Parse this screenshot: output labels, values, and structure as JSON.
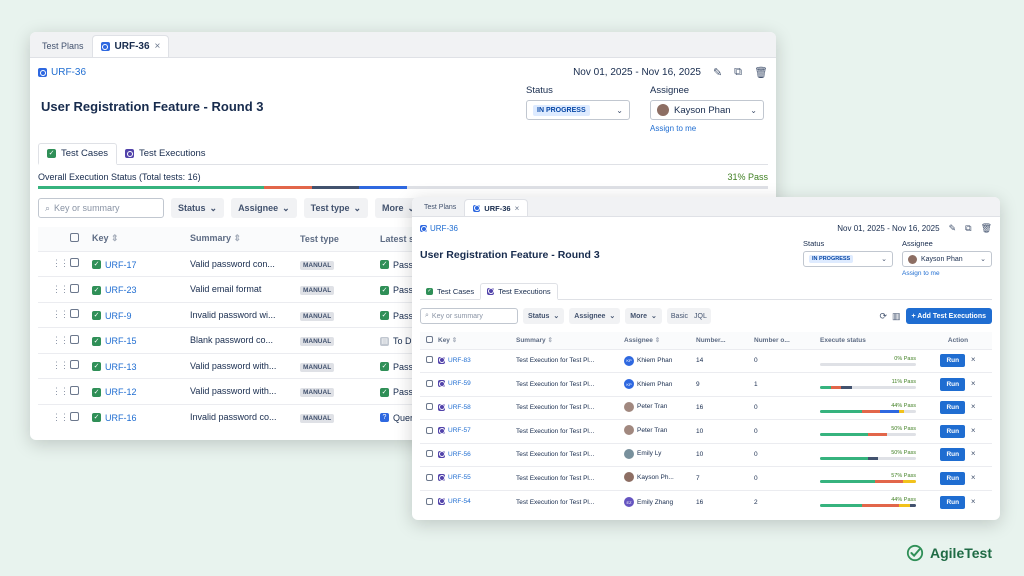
{
  "colors": {
    "pass": "#36b37e",
    "fail": "#e2664a",
    "todo": "#42526e",
    "exec": "#2e68e0",
    "blocked": "#f2c21b"
  },
  "back": {
    "tabs": [
      {
        "label": "Test Plans"
      },
      {
        "label": "URF-36",
        "close": "×"
      }
    ],
    "key": "URF-36",
    "date_range": "Nov 01, 2025 - Nov 16, 2025",
    "title": "User Registration Feature - Round 3",
    "status_label": "Status",
    "status_value": "IN PROGRESS",
    "assignee_label": "Assignee",
    "assignee_value": "Kayson Phan",
    "assign_to_me": "Assign to me",
    "subtabs": [
      "Test Cases",
      "Test Executions"
    ],
    "overall_status": "Overall Execution Status (Total tests: 16)",
    "overall_pass": "31% Pass",
    "overall_progress": [
      {
        "status": "pass",
        "pct": 31
      },
      {
        "status": "fail",
        "pct": 6.5
      },
      {
        "status": "todo",
        "pct": 6.5
      },
      {
        "status": "exec",
        "pct": 6.5
      }
    ],
    "search_placeholder": "Key or summary",
    "filters": [
      "Status",
      "Assignee",
      "Test type",
      "More"
    ],
    "columns": {
      "key": "Key",
      "summary": "Summary",
      "type": "Test type",
      "latest": "Latest s"
    },
    "rows": [
      {
        "key": "URF-17",
        "summary": "Valid password con...",
        "type": "MANUAL",
        "latest": "Pass"
      },
      {
        "key": "URF-23",
        "summary": "Valid email format",
        "type": "MANUAL",
        "latest": "Pass"
      },
      {
        "key": "URF-9",
        "summary": "Invalid password wi...",
        "type": "MANUAL",
        "latest": "Pass"
      },
      {
        "key": "URF-15",
        "summary": "Blank password co...",
        "type": "MANUAL",
        "latest": "To D"
      },
      {
        "key": "URF-13",
        "summary": "Valid password with...",
        "type": "MANUAL",
        "latest": "Pass"
      },
      {
        "key": "URF-12",
        "summary": "Valid password with...",
        "type": "MANUAL",
        "latest": "Pass"
      },
      {
        "key": "URF-16",
        "summary": "Invalid password co...",
        "type": "MANUAL",
        "latest": "Quer"
      }
    ]
  },
  "front": {
    "tabs": [
      {
        "label": "Test Plans"
      },
      {
        "label": "URF-36",
        "close": "×"
      }
    ],
    "key": "URF-36",
    "date_range": "Nov 01, 2025 - Nov 16, 2025",
    "title": "User Registration Feature - Round 3",
    "status_label": "Status",
    "status_value": "IN PROGRESS",
    "assignee_label": "Assignee",
    "assignee_value": "Kayson Phan",
    "assign_to_me": "Assign to me",
    "subtabs": [
      "Test Cases",
      "Test Executions"
    ],
    "search_placeholder": "Key or summary",
    "filters": [
      "Status",
      "Assignee",
      "More"
    ],
    "mode_basic": "Basic",
    "mode_jql": "JQL",
    "add_button": "+ Add Test Executions",
    "columns": {
      "key": "Key",
      "summary": "Summary",
      "assignee": "Assignee",
      "num1": "Number...",
      "num2": "Number o...",
      "exec": "Execute status",
      "action": "Action"
    },
    "run_label": "Run",
    "remove": "×",
    "rows": [
      {
        "key": "URF-83",
        "summary": "Test Execution for Test Pl...",
        "assignee": "Khiem Phan",
        "initials": "KP",
        "n1": "14",
        "n2": "0",
        "pass": "0% Pass",
        "bar": []
      },
      {
        "key": "URF-59",
        "summary": "Test Execution for Test Pl...",
        "assignee": "Khiem Phan",
        "initials": "KP",
        "n1": "9",
        "n2": "1",
        "pass": "11% Pass",
        "bar": [
          {
            "status": "pass",
            "pct": 11
          },
          {
            "status": "fail",
            "pct": 11
          },
          {
            "status": "todo",
            "pct": 11
          }
        ]
      },
      {
        "key": "URF-58",
        "summary": "Test Execution for Test Pl...",
        "assignee": "Peter Tran",
        "initials": "",
        "n1": "16",
        "n2": "0",
        "pass": "44% Pass",
        "bar": [
          {
            "status": "pass",
            "pct": 44
          },
          {
            "status": "fail",
            "pct": 19
          },
          {
            "status": "exec",
            "pct": 19
          },
          {
            "status": "blocked",
            "pct": 6
          }
        ]
      },
      {
        "key": "URF-57",
        "summary": "Test Execution for Test Pl...",
        "assignee": "Peter Tran",
        "initials": "",
        "n1": "10",
        "n2": "0",
        "pass": "50% Pass",
        "bar": [
          {
            "status": "pass",
            "pct": 50
          },
          {
            "status": "fail",
            "pct": 20
          }
        ]
      },
      {
        "key": "URF-56",
        "summary": "Test Execution for Test Pl...",
        "assignee": "Emily Ly",
        "initials": "",
        "n1": "10",
        "n2": "0",
        "pass": "50% Pass",
        "bar": [
          {
            "status": "pass",
            "pct": 50
          },
          {
            "status": "todo",
            "pct": 10
          }
        ]
      },
      {
        "key": "URF-55",
        "summary": "Test Execution for Test Pl...",
        "assignee": "Kayson Ph...",
        "initials": "",
        "n1": "7",
        "n2": "0",
        "pass": "57% Pass",
        "bar": [
          {
            "status": "pass",
            "pct": 57
          },
          {
            "status": "fail",
            "pct": 29
          },
          {
            "status": "blocked",
            "pct": 14
          }
        ]
      },
      {
        "key": "URF-54",
        "summary": "Test Execution for Test Pl...",
        "assignee": "Emily Zhang",
        "initials": "EZ",
        "n1": "16",
        "n2": "2",
        "pass": "44% Pass",
        "bar": [
          {
            "status": "pass",
            "pct": 44
          },
          {
            "status": "fail",
            "pct": 38
          },
          {
            "status": "blocked",
            "pct": 12
          },
          {
            "status": "todo",
            "pct": 6
          }
        ]
      }
    ]
  },
  "brand": {
    "name": "AgileTest"
  }
}
